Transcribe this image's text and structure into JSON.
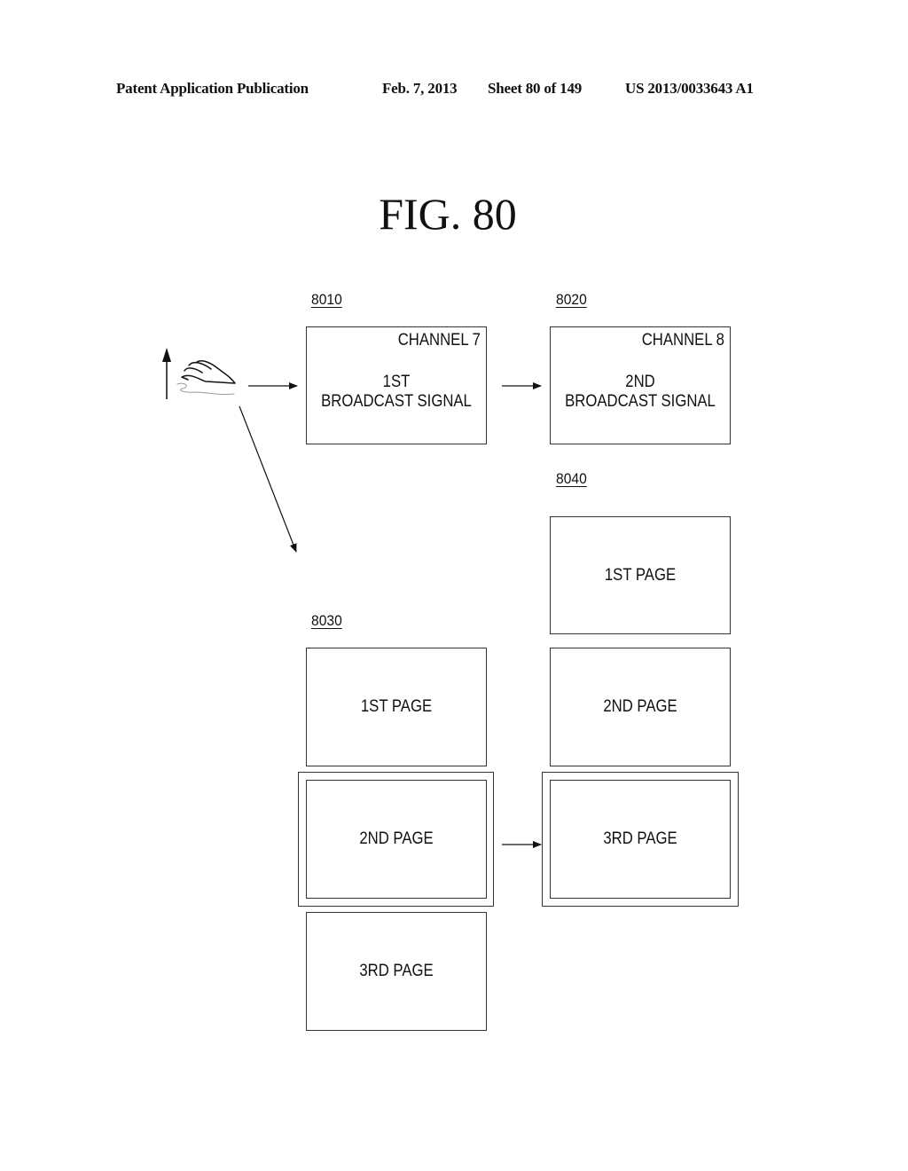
{
  "header": {
    "publication": "Patent Application Publication",
    "date": "Feb. 7, 2013",
    "sheet": "Sheet 80 of 149",
    "number": "US 2013/0033643 A1"
  },
  "figure": {
    "title": "FIG. 80"
  },
  "screens": {
    "s8010": {
      "ref": "8010",
      "channel": "CHANNEL 7",
      "line1": "1ST",
      "line2": "BROADCAST SIGNAL"
    },
    "s8020": {
      "ref": "8020",
      "channel": "CHANNEL 8",
      "line1": "2ND",
      "line2": "BROADCAST SIGNAL"
    },
    "s8030": {
      "ref": "8030",
      "pages": [
        "1ST PAGE",
        "2ND PAGE",
        "3RD PAGE"
      ],
      "selected_page": "2ND PAGE"
    },
    "s8040": {
      "ref": "8040",
      "pages": [
        "1ST PAGE",
        "2ND PAGE",
        "3RD PAGE"
      ],
      "selected_page": "3RD PAGE"
    }
  },
  "gesture": {
    "icon": "hand-wave-up-icon",
    "direction": "up"
  }
}
